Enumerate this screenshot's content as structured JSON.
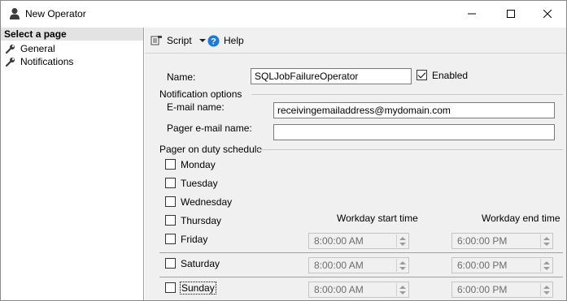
{
  "window": {
    "title": "New Operator"
  },
  "left_panel": {
    "header": "Select a page",
    "items": [
      {
        "label": "General",
        "icon": "wrench-icon"
      },
      {
        "label": "Notifications",
        "icon": "wrench-icon"
      }
    ]
  },
  "toolbar": {
    "script_label": "Script",
    "help_label": "Help"
  },
  "form": {
    "name_label": "Name:",
    "name_value": "SQLJobFailureOperator",
    "enabled_label": "Enabled",
    "enabled_checked": true,
    "notification_options_label": "Notification options",
    "email_label": "E-mail name:",
    "email_value": "receivingemailaddress@mydomain.com",
    "pager_email_label": "Pager e-mail name:",
    "pager_email_value": "",
    "pager_schedule_label": "Pager on duty schedule",
    "start_time_header": "Workday start time",
    "end_time_header": "Workday end time",
    "days": [
      {
        "label": "Monday",
        "checked": false
      },
      {
        "label": "Tuesday",
        "checked": false
      },
      {
        "label": "Wednesday",
        "checked": false
      },
      {
        "label": "Thursday",
        "checked": false
      },
      {
        "label": "Friday",
        "checked": false,
        "start": "8:00:00 AM",
        "end": "6:00:00 PM"
      },
      {
        "label": "Saturday",
        "checked": false,
        "start": "8:00:00 AM",
        "end": "6:00:00 PM"
      },
      {
        "label": "Sunday",
        "checked": false,
        "start": "8:00:00 AM",
        "end": "6:00:00 PM"
      }
    ]
  },
  "colors": {
    "accent_blue": "#1e7bd4",
    "panel_bg": "#f0f0f0",
    "header_bg": "#e3e3e3"
  }
}
